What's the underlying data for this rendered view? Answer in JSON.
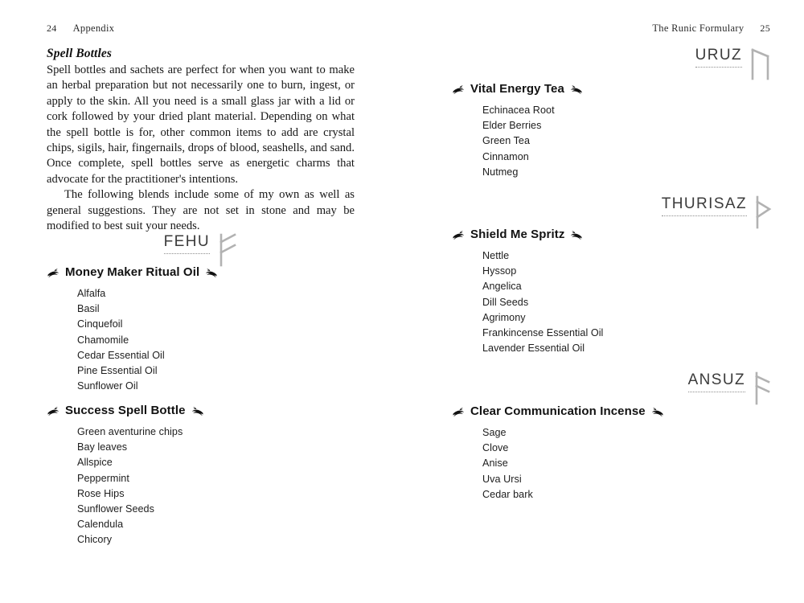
{
  "spread": {
    "verso": {
      "running_head": {
        "folio": "24",
        "title": "Appendix"
      },
      "section_heading": "Spell Bottles",
      "paragraphs": [
        "Spell bottles and sachets are perfect for when you want to make an herbal preparation but not necessarily one to burn, ingest, or apply to the skin. All you need is a small glass jar with a lid or cork followed by your dried plant material. Depending on what the spell bottle is for, other common items to add are crystal chips, sigils, hair, fingernails, drops of blood, seashells, and sand. Once complete, spell bottles serve as energetic charms that advocate for the practitioner's intentions.",
        "The following blends include some of my own as well as general suggestions. They are not set in stone and may be modified to best suit your needs."
      ],
      "runes": [
        {
          "name": "FEHU",
          "glyph": "fehu-rune-icon"
        }
      ],
      "recipes": [
        {
          "title": "Money Maker Ritual Oil",
          "ingredients": [
            "Alfalfa",
            "Basil",
            "Cinquefoil",
            "Chamomile",
            "Cedar Essential Oil",
            "Pine Essential Oil",
            "Sunflower Oil"
          ]
        },
        {
          "title": "Success Spell Bottle",
          "ingredients": [
            "Green aventurine chips",
            "Bay leaves",
            "Allspice",
            "Peppermint",
            "Rose Hips",
            "Sunflower Seeds",
            "Calendula",
            "Chicory"
          ]
        }
      ]
    },
    "recto": {
      "running_head": {
        "folio": "25",
        "title": "The Runic Formulary"
      },
      "runes": [
        {
          "name": "URUZ",
          "glyph": "uruz-rune-icon"
        },
        {
          "name": "THURISAZ",
          "glyph": "thurisaz-rune-icon"
        },
        {
          "name": "ANSUZ",
          "glyph": "ansuz-rune-icon"
        }
      ],
      "recipes": [
        {
          "title": "Vital Energy Tea",
          "ingredients": [
            "Echinacea Root",
            "Elder Berries",
            "Green Tea",
            "Cinnamon",
            "Nutmeg"
          ]
        },
        {
          "title": "Shield Me Spritz",
          "ingredients": [
            "Nettle",
            "Hyssop",
            "Angelica",
            "Dill Seeds",
            "Agrimony",
            "Frankincense Essential Oil",
            "Lavender Essential Oil"
          ]
        },
        {
          "title": "Clear Communication Incense",
          "ingredients": [
            "Sage",
            "Clove",
            "Anise",
            "Uva Ursi",
            "Cedar bark"
          ]
        }
      ]
    }
  },
  "colors": {
    "page_background": "#ffffff",
    "body_text": "#171717",
    "rune_glyph": "#b2b2b2",
    "rune_name": "#3b3b3b",
    "dotted_rule": "#8d8d8d"
  }
}
